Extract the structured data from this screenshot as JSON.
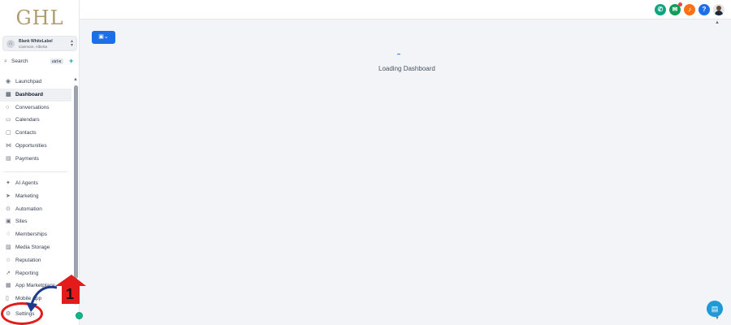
{
  "brand": {
    "logo": "GHL"
  },
  "account": {
    "name": "Blank WhiteLabel",
    "location": "Canmore, Alberta"
  },
  "search": {
    "label": "Search",
    "shortcut": "ctrl K"
  },
  "nav_primary": [
    {
      "label": "Launchpad",
      "icon": "rocket-icon"
    },
    {
      "label": "Dashboard",
      "icon": "grid-icon",
      "active": true
    },
    {
      "label": "Conversations",
      "icon": "chat-icon"
    },
    {
      "label": "Calendars",
      "icon": "calendar-icon"
    },
    {
      "label": "Contacts",
      "icon": "contacts-icon"
    },
    {
      "label": "Opportunities",
      "icon": "funnel-icon"
    },
    {
      "label": "Payments",
      "icon": "receipt-icon"
    }
  ],
  "nav_secondary": [
    {
      "label": "AI Agents",
      "icon": "sparkle-icon"
    },
    {
      "label": "Marketing",
      "icon": "send-icon"
    },
    {
      "label": "Automation",
      "icon": "automation-icon"
    },
    {
      "label": "Sites",
      "icon": "sites-icon"
    },
    {
      "label": "Memberships",
      "icon": "membership-icon"
    },
    {
      "label": "Media Storage",
      "icon": "image-icon"
    },
    {
      "label": "Reputation",
      "icon": "star-icon"
    },
    {
      "label": "Reporting",
      "icon": "chart-icon"
    },
    {
      "label": "App Marketplace",
      "icon": "apps-icon"
    },
    {
      "label": "Mobile App",
      "icon": "phone-icon"
    }
  ],
  "settings": {
    "label": "Settings",
    "icon": "gear-icon"
  },
  "main": {
    "loading_text": "Loading Dashboard"
  },
  "annotation": {
    "step_number": "1",
    "color": "#e31b1b"
  },
  "colors": {
    "accent": "#1d6fe8",
    "logo": "#b09a6e"
  }
}
